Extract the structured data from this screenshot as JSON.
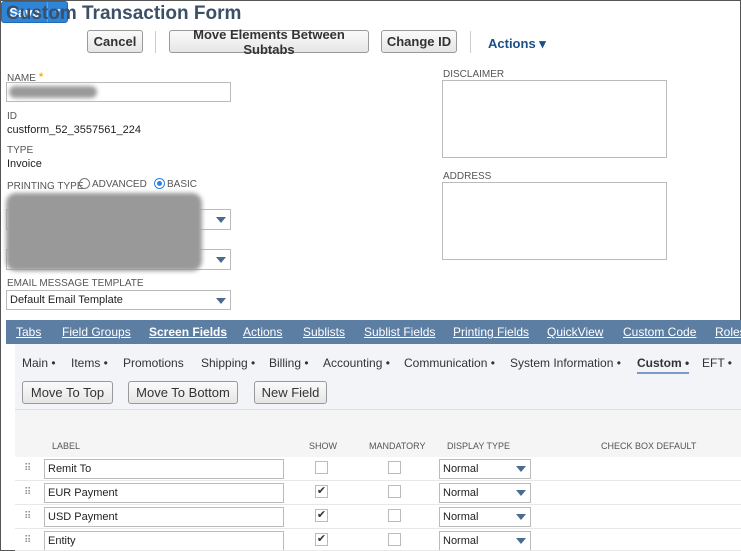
{
  "page": {
    "title": "Custom Transaction Form"
  },
  "toolbar": {
    "save_label": "Save",
    "save_arrow": "▼",
    "cancel_label": "Cancel",
    "move_label": "Move Elements Between Subtabs",
    "changeid_label": "Change ID",
    "actions_label": "Actions ▾"
  },
  "form": {
    "name_label": "NAME",
    "required_mark": "*",
    "id_label": "ID",
    "id_value": "custform_52_3557561_224",
    "type_label": "TYPE",
    "type_value": "Invoice",
    "printing_type_label": "PRINTING TYPE",
    "printing_advanced": "ADVANCED",
    "printing_basic": "BASIC",
    "email_template_label": "EMAIL MESSAGE TEMPLATE",
    "email_template_value": "Default Email Template",
    "disclaimer_label": "DISCLAIMER",
    "address_label": "ADDRESS"
  },
  "tabs": [
    "Tabs",
    "Field Groups",
    "Screen Fields",
    "Actions",
    "Sublists",
    "Sublist Fields",
    "Printing Fields",
    "QuickView",
    "Custom Code",
    "Roles"
  ],
  "subtabs": [
    "Main •",
    "Items •",
    "Promotions",
    "Shipping •",
    "Billing •",
    "Accounting •",
    "Communication •",
    "System Information •",
    "Custom •",
    "EFT •"
  ],
  "field_buttons": {
    "top": "Move To Top",
    "bottom": "Move To Bottom",
    "new": "New Field"
  },
  "columns": {
    "label": "LABEL",
    "show": "SHOW",
    "mandatory": "MANDATORY",
    "display_type": "DISPLAY TYPE",
    "checkbox_default": "CHECK BOX DEFAULT"
  },
  "rows": [
    {
      "label": "Remit To",
      "show": false,
      "display": "Normal"
    },
    {
      "label": "EUR Payment",
      "show": true,
      "display": "Normal"
    },
    {
      "label": "USD Payment",
      "show": true,
      "display": "Normal"
    },
    {
      "label": "Entity",
      "show": true,
      "display": "Normal"
    }
  ],
  "glyphs": {
    "grip": "⠿",
    "check": "✔"
  }
}
